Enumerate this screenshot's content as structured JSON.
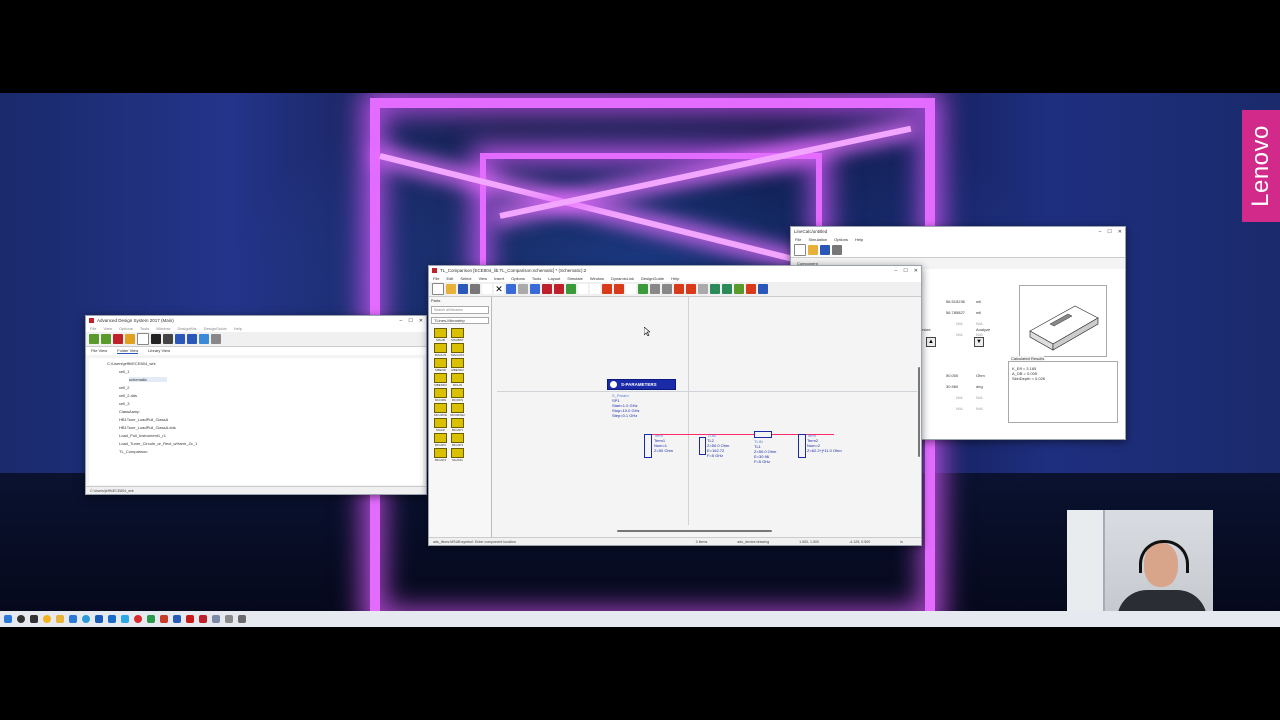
{
  "desktop": {
    "brand": "Lenovo"
  },
  "ads_main": {
    "title": "Advanced Design System 2017 (Main)",
    "menus": [
      "File",
      "View",
      "Options",
      "Tools",
      "Window",
      "DesignKits",
      "DesignGuide",
      "Help"
    ],
    "tabs": [
      "File View",
      "Folder View",
      "Library View"
    ],
    "tree": [
      "C:\\Users\\jeffh\\ECE804_wrk",
      "cell_1",
      "schematic",
      "cell_2",
      "cell_2.dds",
      "cell_3",
      "ClassAamp",
      "HB1Tone_LoadPull_ClassA",
      "HB1Tone_LoadPull_ClassA.dds",
      "Load_Pull_Instrument1_r1",
      "Load_Tuner_Circule_or_Rect_wHarm_Zc_1",
      "TL_Comparison"
    ],
    "status": "C:\\Users\\jeffh\\ECE804_wrk"
  },
  "schematic": {
    "title": "TL_Comparison [ECE804_lib:TL_Comparison:schematic] * (Schematic):2",
    "menus": [
      "File",
      "Edit",
      "Select",
      "View",
      "Insert",
      "Options",
      "Tools",
      "Layout",
      "Simulate",
      "Window",
      "DynamicLink",
      "DesignGuide",
      "Help"
    ],
    "palette_header": "Parts",
    "search_placeholder": "Search all libraries",
    "palette_category": "TLines-Microstrip",
    "palette_items": [
      "MSUB",
      "MSUBST",
      "MACLIN",
      "MACLIN3",
      "MBEND",
      "MBEND2",
      "MBEND3",
      "MCLIN",
      "MCORN",
      "MCROS",
      "MCURVE",
      "MCURVE2",
      "MGAP",
      "MICAP1",
      "MICAP2",
      "MICAP3",
      "MICAP4",
      "MLANG",
      "MLANG6"
    ],
    "sp_block": {
      "label": "S-PARAMETERS",
      "lines": [
        "S_Param",
        "SP1",
        "Start=1.0 GHz",
        "Stop=10.0 GHz",
        "Step=0.1 GHz"
      ]
    },
    "term1": [
      "Term",
      "Term1",
      "Num=1",
      "Z=50 Ohm"
    ],
    "tl2": [
      "TLIN",
      "TL2",
      "Z=50.0 Ohm",
      "E=162.72",
      "F=5 GHz"
    ],
    "tl1": [
      "TLIN",
      "TL1",
      "Z=50.0 Ohm",
      "E=30.96",
      "F=5 GHz"
    ],
    "term2": [
      "Term",
      "Term2",
      "Num=2",
      "Z=62.2+j*11.0 Ohm"
    ],
    "status_left": "ads_tlines:MSUB:symbol: Enter component location",
    "status_mid": "0 items",
    "status_right": "ads_device:drawing",
    "status_coords": "1.500, 1.500",
    "status_coords2": "-4.125, 0.500",
    "status_unit": "in"
  },
  "linecalc": {
    "title": "LineCalc/untitled",
    "menus": [
      "File",
      "Simulation",
      "Options",
      "Help"
    ],
    "component_label": "Component",
    "values": [
      "56.515236",
      "56.785827",
      "N/A",
      "N/A",
      "50.000",
      "30.960",
      "N/A",
      "N/A"
    ],
    "units": [
      "mil",
      "mil",
      "N/A",
      "N/A",
      "Ohm",
      "deg",
      "N/A",
      "N/A"
    ],
    "synth_label": "Synthesize",
    "analyze_label": "Analyze",
    "results_label": "Calculated Results",
    "results": [
      "K_Eff = 3.165",
      "A_DB = 0.005",
      "SkinDepth = 0.026"
    ]
  }
}
